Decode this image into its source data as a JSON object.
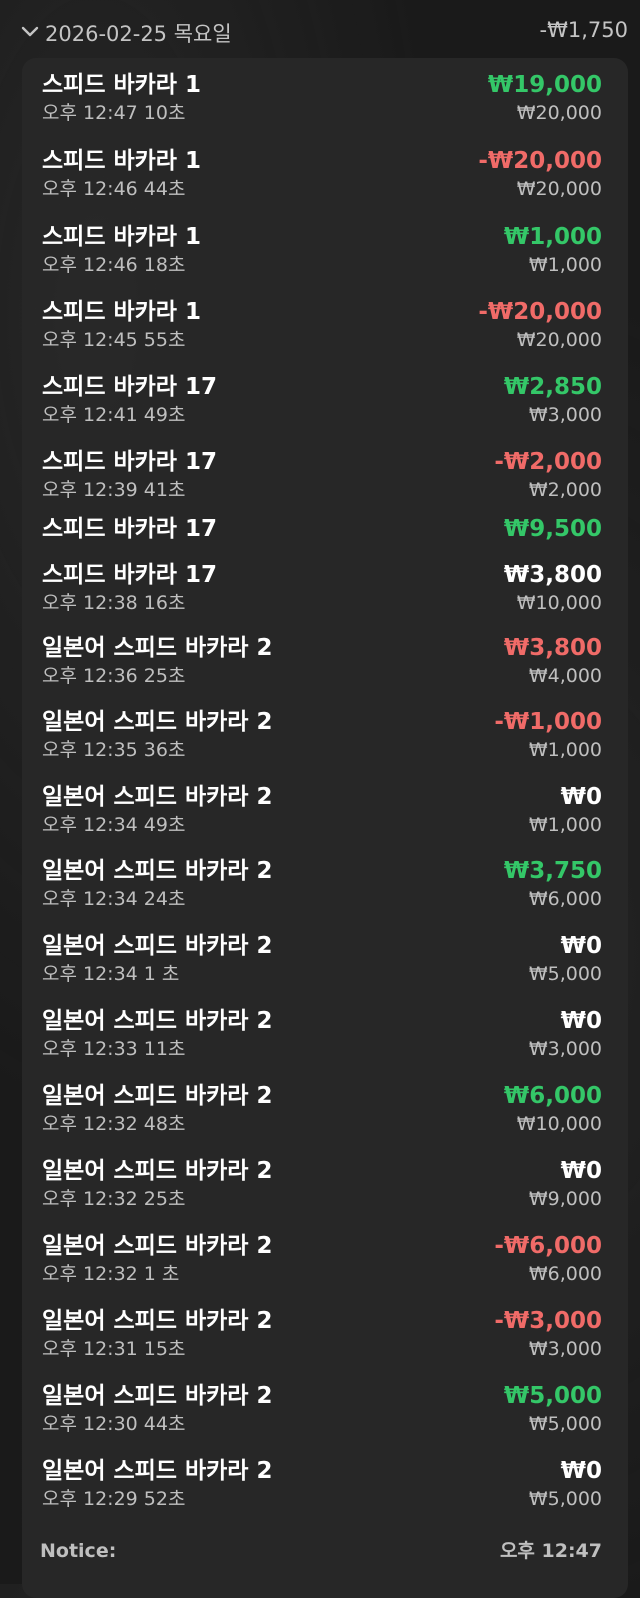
{
  "header": {
    "date": "2026-02-25 목요일",
    "total": "-₩1,750"
  },
  "transactions": [
    {
      "name": "스피드 바카라 1",
      "time": "오후 12:47 10초",
      "result": "₩19,000",
      "status": "win",
      "bet": "₩20,000"
    },
    {
      "name": "스피드 바카라 1",
      "time": "오후 12:46 44초",
      "result": "-₩20,000",
      "status": "loss",
      "bet": "₩20,000"
    },
    {
      "name": "스피드 바카라 1",
      "time": "오후 12:46 18초",
      "result": "₩1,000",
      "status": "win",
      "bet": "₩1,000"
    },
    {
      "name": "스피드 바카라 1",
      "time": "오후 12:45 55초",
      "result": "-₩20,000",
      "status": "loss",
      "bet": "₩20,000"
    },
    {
      "name": "스피드 바카라 17",
      "time": "오후 12:41 49초",
      "result": "₩2,850",
      "status": "win",
      "bet": "₩3,000"
    },
    {
      "name": "스피드 바카라 17",
      "time": "오후 12:39 41초",
      "result": "-₩2,000",
      "status": "loss",
      "bet": "₩2,000"
    },
    {
      "name": "스피드 바카라 17",
      "time": "",
      "result": "₩9,500",
      "status": "win",
      "bet": ""
    },
    {
      "name": "스피드 바카라 17",
      "time": "오후 12:38 16초",
      "result": "₩3,800",
      "status": "neutral",
      "bet": "₩10,000"
    },
    {
      "name": "일본어 스피드 바카라 2",
      "time": "오후 12:36 25초",
      "result": "₩3,800",
      "status": "loss",
      "bet": "₩4,000"
    },
    {
      "name": "일본어 스피드 바카라 2",
      "time": "오후 12:35 36초",
      "result": "-₩1,000",
      "status": "loss",
      "bet": "₩1,000"
    },
    {
      "name": "일본어 스피드 바카라 2",
      "time": "오후 12:34 49초",
      "result": "₩0",
      "status": "neutral",
      "bet": "₩1,000"
    },
    {
      "name": "일본어 스피드 바카라 2",
      "time": "오후 12:34 24초",
      "result": "₩3,750",
      "status": "win",
      "bet": "₩6,000"
    },
    {
      "name": "일본어 스피드 바카라 2",
      "time": "오후 12:34 1 초",
      "result": "₩0",
      "status": "neutral",
      "bet": "₩5,000"
    },
    {
      "name": "일본어 스피드 바카라 2",
      "time": "오후 12:33 11초",
      "result": "₩0",
      "status": "neutral",
      "bet": "₩3,000"
    },
    {
      "name": "일본어 스피드 바카라 2",
      "time": "오후 12:32 48초",
      "result": "₩6,000",
      "status": "win",
      "bet": "₩10,000"
    },
    {
      "name": "일본어 스피드 바카라 2",
      "time": "오후 12:32 25초",
      "result": "₩0",
      "status": "neutral",
      "bet": "₩9,000"
    },
    {
      "name": "일본어 스피드 바카라 2",
      "time": "오후 12:32 1 초",
      "result": "-₩6,000",
      "status": "loss",
      "bet": "₩6,000"
    },
    {
      "name": "일본어 스피드 바카라 2",
      "time": "오후 12:31 15초",
      "result": "-₩3,000",
      "status": "loss",
      "bet": "₩3,000"
    },
    {
      "name": "일본어 스피드 바카라 2",
      "time": "오후 12:30 44초",
      "result": "₩5,000",
      "status": "win",
      "bet": "₩5,000"
    },
    {
      "name": "일본어 스피드 바카라 2",
      "time": "오후 12:29 52초",
      "result": "₩0",
      "status": "neutral",
      "bet": "₩5,000"
    }
  ],
  "notice": {
    "label": "Notice:",
    "time": "오후 12:47"
  },
  "colors": {
    "win": "#34c768",
    "loss": "#f06b68",
    "neutral": "#ffffff",
    "secondary_text": "#bfbfbf",
    "card_bg": "#282828",
    "page_bg": "#1a1a1a"
  },
  "icons": {
    "collapse": "chevron-down-icon"
  }
}
